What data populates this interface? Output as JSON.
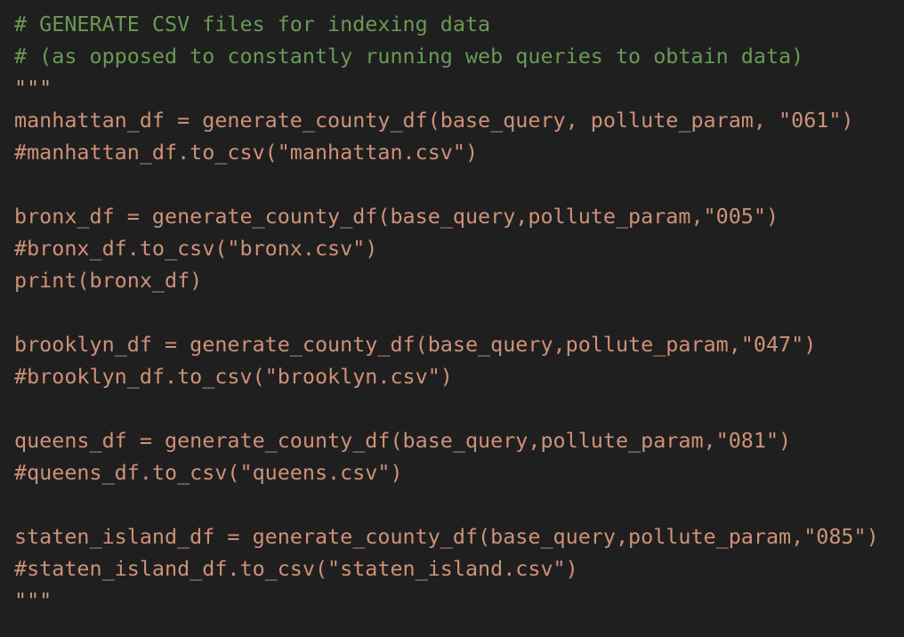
{
  "editor": {
    "colors": {
      "background": "#1f1f1f",
      "comment": "#6a9955",
      "string": "#ce9178"
    },
    "lines": [
      {
        "text": "# GENERATE CSV files for indexing data",
        "kind": "comment"
      },
      {
        "text": "# (as opposed to constantly running web queries to obtain data)",
        "kind": "comment"
      },
      {
        "text": "\"\"\"",
        "kind": "string"
      },
      {
        "text": "manhattan_df = generate_county_df(base_query, pollute_param, \"061\")",
        "kind": "string"
      },
      {
        "text": "#manhattan_df.to_csv(\"manhattan.csv\")",
        "kind": "string"
      },
      {
        "text": "",
        "kind": "blank"
      },
      {
        "text": "bronx_df = generate_county_df(base_query,pollute_param,\"005\")",
        "kind": "string"
      },
      {
        "text": "#bronx_df.to_csv(\"bronx.csv\")",
        "kind": "string"
      },
      {
        "text": "print(bronx_df)",
        "kind": "string"
      },
      {
        "text": "",
        "kind": "blank"
      },
      {
        "text": "brooklyn_df = generate_county_df(base_query,pollute_param,\"047\")",
        "kind": "string"
      },
      {
        "text": "#brooklyn_df.to_csv(\"brooklyn.csv\")",
        "kind": "string"
      },
      {
        "text": "",
        "kind": "blank"
      },
      {
        "text": "queens_df = generate_county_df(base_query,pollute_param,\"081\")",
        "kind": "string"
      },
      {
        "text": "#queens_df.to_csv(\"queens.csv\")",
        "kind": "string"
      },
      {
        "text": "",
        "kind": "blank"
      },
      {
        "text": "staten_island_df = generate_county_df(base_query,pollute_param,\"085\")",
        "kind": "string"
      },
      {
        "text": "#staten_island_df.to_csv(\"staten_island.csv\")",
        "kind": "string"
      },
      {
        "text": "\"\"\"",
        "kind": "string"
      }
    ]
  }
}
